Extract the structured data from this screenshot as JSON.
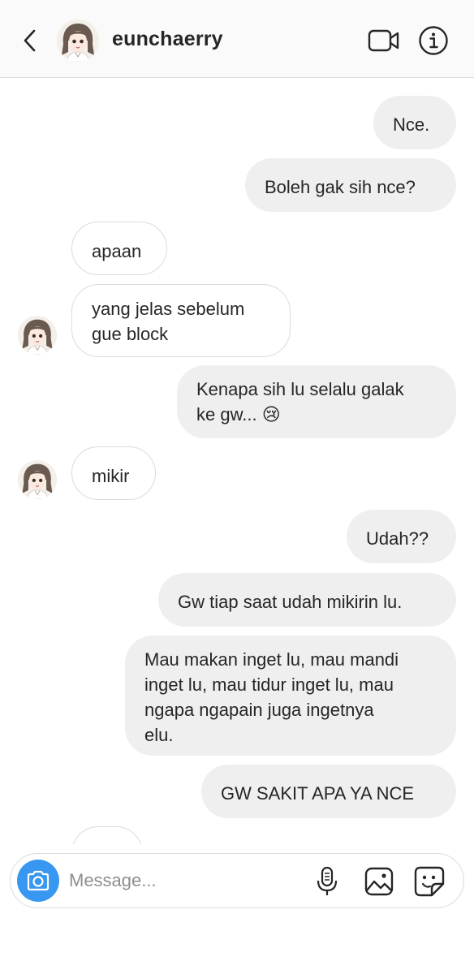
{
  "header": {
    "username": "eunchaerry",
    "avatar_icon": "profile-photo-girl-illustration",
    "back_icon": "chevron-left-icon",
    "video_icon": "video-camera-icon",
    "info_icon": "info-icon"
  },
  "messages": [
    {
      "sender": "me",
      "text": "Nce."
    },
    {
      "sender": "me",
      "text": "Boleh gak sih nce?"
    },
    {
      "sender": "them",
      "text": "apaan"
    },
    {
      "sender": "them",
      "lines": [
        "yang jelas sebelum",
        "gue block"
      ]
    },
    {
      "sender": "me",
      "lines": [
        "Kenapa sih lu selalu galak",
        "ke gw... 😢"
      ]
    },
    {
      "sender": "them",
      "text": "mikir"
    },
    {
      "sender": "me",
      "text": "Udah??"
    },
    {
      "sender": "me",
      "text": "Gw tiap saat udah mikirin lu."
    },
    {
      "sender": "me",
      "lines": [
        "Mau makan inget lu, mau mandi",
        "inget lu, mau tidur inget lu, mau",
        "ngapa ngapain juga ingetnya",
        "elu."
      ]
    },
    {
      "sender": "me",
      "text": "GW SAKIT APA YA NCE"
    }
  ],
  "composer": {
    "placeholder": "Message...",
    "camera_icon": "camera-icon",
    "mic_icon": "microphone-icon",
    "gallery_icon": "image-gallery-icon",
    "sticker_icon": "sticker-icon"
  },
  "colors": {
    "outgoing_bubble": "#efefef",
    "incoming_border": "#dbdbdb",
    "camera_button": "#3897f0",
    "header_bg": "#fafafa"
  }
}
